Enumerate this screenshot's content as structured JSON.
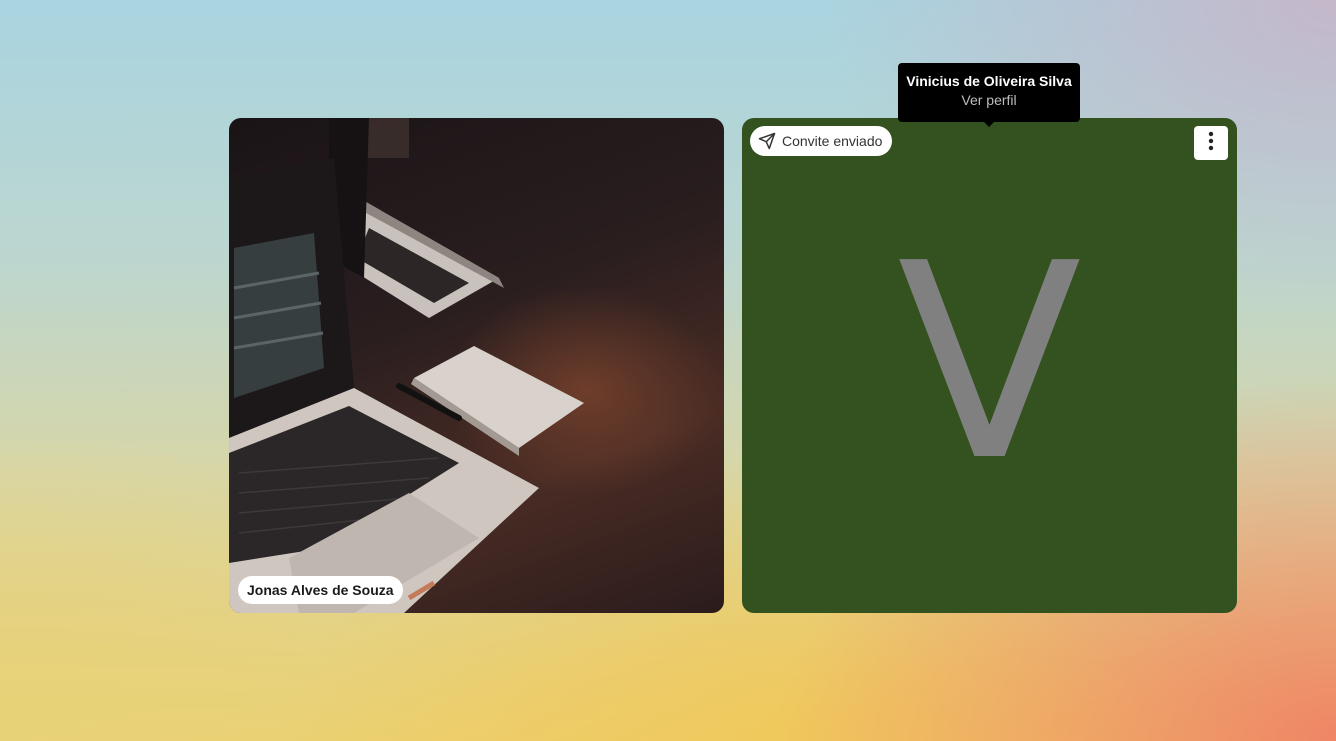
{
  "participants": [
    {
      "name": "Jonas Alves de Souza",
      "avatar_type": "photo",
      "photo_subject": "laptops-on-desk"
    },
    {
      "name": "Vinicius de Oliveira Silva",
      "avatar_type": "initial",
      "initial": "V",
      "tile_color": "#33521f",
      "initial_color": "#808080",
      "status": "Convite enviado",
      "status_icon": "send-icon",
      "menu_icon": "more-vertical-icon"
    }
  ],
  "tooltip": {
    "name": "Vinicius de Oliveira Silva",
    "link": "Ver perfil"
  }
}
